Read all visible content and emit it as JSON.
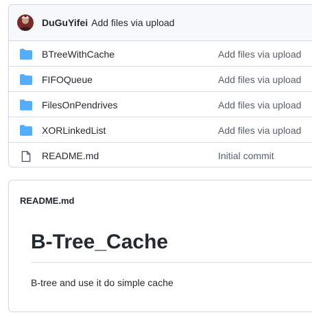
{
  "commit_header": {
    "author": "DuGuYifei",
    "message": "Add files via upload"
  },
  "files": [
    {
      "name": "BTreeWithCache",
      "type": "folder",
      "icon": "folder-icon",
      "commit": "Add files via upload"
    },
    {
      "name": "FIFOQueue",
      "type": "folder",
      "icon": "folder-icon",
      "commit": "Add files via upload"
    },
    {
      "name": "FilesOnPendrives",
      "type": "folder",
      "icon": "folder-icon",
      "commit": "Add files via upload"
    },
    {
      "name": "XORLinkedList",
      "type": "folder",
      "icon": "folder-icon",
      "commit": "Add files via upload"
    },
    {
      "name": "README.md",
      "type": "file",
      "icon": "file-icon",
      "commit": "Initial commit"
    }
  ],
  "readme": {
    "header": "README.md",
    "title": "B-Tree_Cache",
    "body": "B-tree and use it do simple cache"
  },
  "colors": {
    "folder": "#54aeff",
    "border": "#d0d7de",
    "header_bg": "#f6f8fa",
    "text": "#24292f",
    "muted": "#57606a"
  }
}
